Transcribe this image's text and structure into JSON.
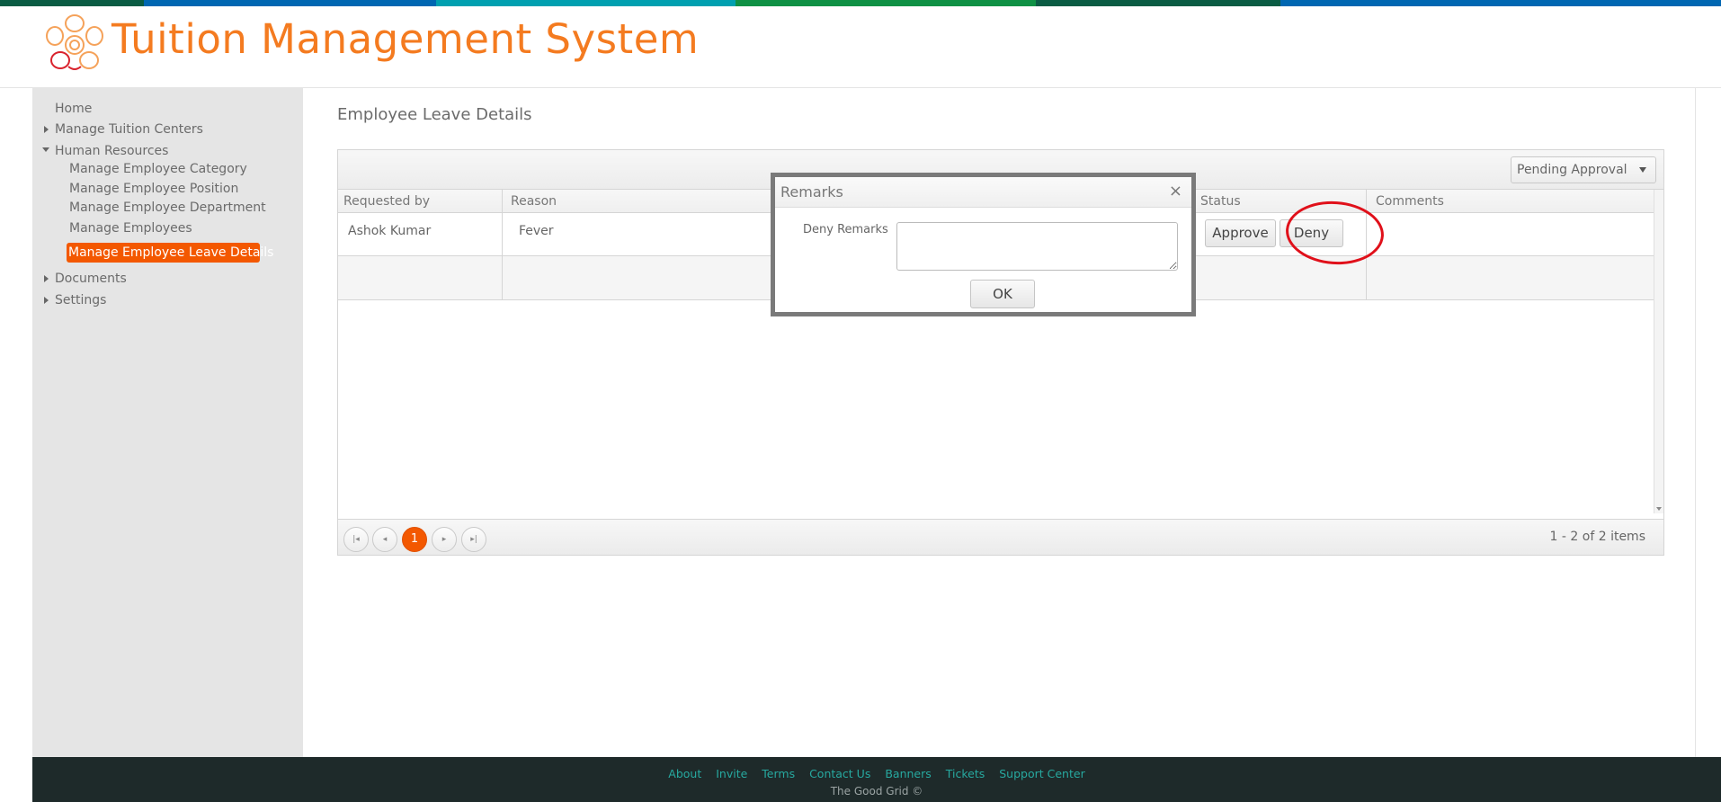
{
  "header": {
    "title": "Tuition Management System",
    "top_bar_colors": [
      "#0a5c44",
      "#0067b2",
      "#00a0b0",
      "#0f9145",
      "#0a5c44",
      "#0067b2"
    ],
    "title_color": "#f47b20"
  },
  "sidebar": {
    "items": [
      {
        "label": "Home"
      },
      {
        "label": "Manage Tuition Centers"
      },
      {
        "label": "Human Resources"
      },
      {
        "label": "Manage Employee Category"
      },
      {
        "label": "Manage Employee Position"
      },
      {
        "label": "Manage Employee Department"
      },
      {
        "label": "Manage Employees"
      },
      {
        "label": "Manage Employee Leave Details"
      },
      {
        "label": "Documents"
      },
      {
        "label": "Settings"
      }
    ],
    "active_color": "#f35800"
  },
  "main": {
    "title": "Employee Leave Details",
    "filter": {
      "selected": "Pending Approval"
    },
    "columns": [
      "Requested by",
      "Reason",
      "Status",
      "Comments"
    ],
    "rows": [
      {
        "requested_by": "Ashok Kumar",
        "reason": "Fever",
        "approve_label": "Approve",
        "deny_label": "Deny"
      }
    ],
    "pager": {
      "current_page": "1",
      "info": "1 - 2 of 2 items"
    }
  },
  "dialog": {
    "title": "Remarks",
    "close_glyph": "×",
    "label": "Deny Remarks",
    "textarea_value": "",
    "ok_label": "OK"
  },
  "footer": {
    "links": [
      "About",
      "Invite",
      "Terms",
      "Contact Us",
      "Banners",
      "Tickets",
      "Support Center"
    ],
    "copyright": "The Good Grid ©"
  }
}
